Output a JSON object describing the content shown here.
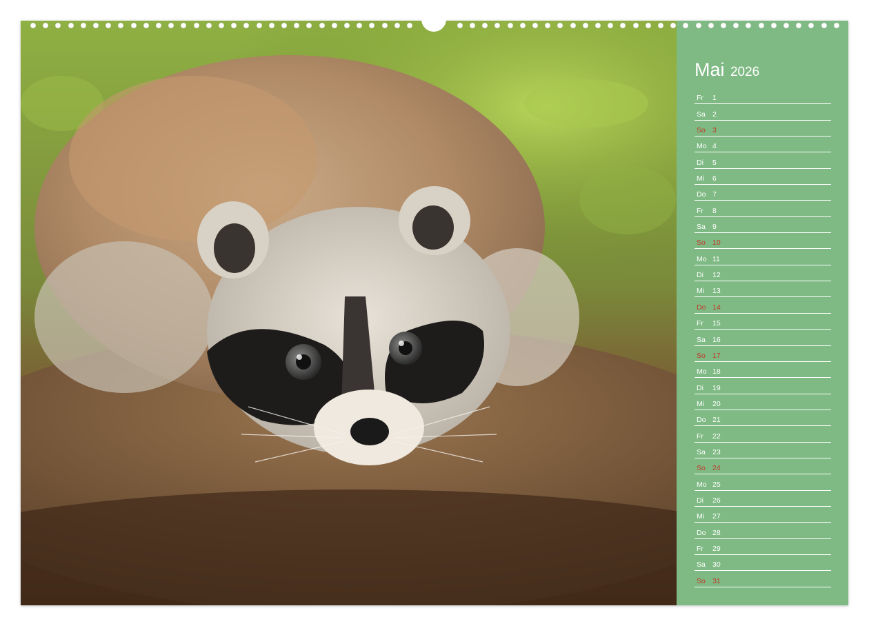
{
  "calendar": {
    "month": "Mai",
    "year": "2026",
    "days": [
      {
        "abbr": "Fr",
        "num": "1",
        "red": false
      },
      {
        "abbr": "Sa",
        "num": "2",
        "red": false
      },
      {
        "abbr": "So",
        "num": "3",
        "red": true
      },
      {
        "abbr": "Mo",
        "num": "4",
        "red": false
      },
      {
        "abbr": "Di",
        "num": "5",
        "red": false
      },
      {
        "abbr": "Mi",
        "num": "6",
        "red": false
      },
      {
        "abbr": "Do",
        "num": "7",
        "red": false
      },
      {
        "abbr": "Fr",
        "num": "8",
        "red": false
      },
      {
        "abbr": "Sa",
        "num": "9",
        "red": false
      },
      {
        "abbr": "So",
        "num": "10",
        "red": true
      },
      {
        "abbr": "Mo",
        "num": "11",
        "red": false
      },
      {
        "abbr": "Di",
        "num": "12",
        "red": false
      },
      {
        "abbr": "Mi",
        "num": "13",
        "red": false
      },
      {
        "abbr": "Do",
        "num": "14",
        "red": true
      },
      {
        "abbr": "Fr",
        "num": "15",
        "red": false
      },
      {
        "abbr": "Sa",
        "num": "16",
        "red": false
      },
      {
        "abbr": "So",
        "num": "17",
        "red": true
      },
      {
        "abbr": "Mo",
        "num": "18",
        "red": false
      },
      {
        "abbr": "Di",
        "num": "19",
        "red": false
      },
      {
        "abbr": "Mi",
        "num": "20",
        "red": false
      },
      {
        "abbr": "Do",
        "num": "21",
        "red": false
      },
      {
        "abbr": "Fr",
        "num": "22",
        "red": false
      },
      {
        "abbr": "Sa",
        "num": "23",
        "red": false
      },
      {
        "abbr": "So",
        "num": "24",
        "red": true
      },
      {
        "abbr": "Mo",
        "num": "25",
        "red": false
      },
      {
        "abbr": "Di",
        "num": "26",
        "red": false
      },
      {
        "abbr": "Mi",
        "num": "27",
        "red": false
      },
      {
        "abbr": "Do",
        "num": "28",
        "red": false
      },
      {
        "abbr": "Fr",
        "num": "29",
        "red": false
      },
      {
        "abbr": "Sa",
        "num": "30",
        "red": false
      },
      {
        "abbr": "So",
        "num": "31",
        "red": true
      }
    ]
  },
  "colors": {
    "sidebar": "#7fba84",
    "text": "#ffffff",
    "holiday": "#c0392b"
  }
}
